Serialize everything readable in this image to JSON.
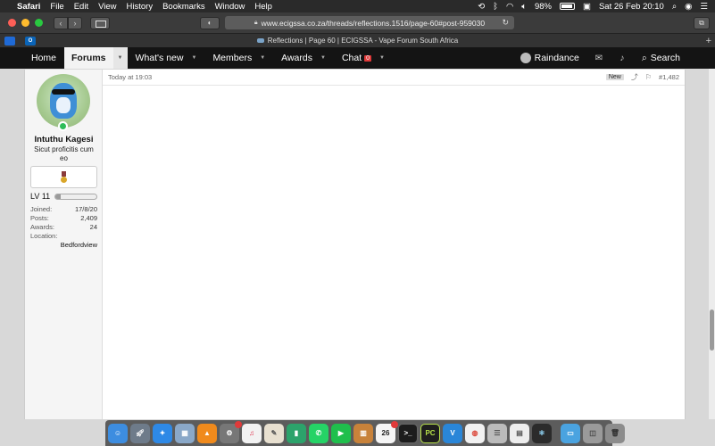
{
  "menubar": {
    "app": "Safari",
    "items": [
      "File",
      "Edit",
      "View",
      "History",
      "Bookmarks",
      "Window",
      "Help"
    ],
    "battery": "98%",
    "datetime": "Sat 26 Feb  20:10"
  },
  "browser": {
    "url": "www.ecigssa.co.za/threads/reflections.1516/page-60#post-959030",
    "tab_title": "Reflections | Page 60 | ECIGSSA - Vape Forum South Africa",
    "favorites": [
      "",
      "O"
    ]
  },
  "nav": {
    "home": "Home",
    "forums": "Forums",
    "whats_new": "What's new",
    "members": "Members",
    "awards": "Awards",
    "chat": "Chat",
    "chat_count": "0",
    "username": "Raindance",
    "search": "Search"
  },
  "post": {
    "time": "Today at 19:03",
    "badge": "New",
    "number": "#1,482",
    "user": {
      "name": "Intuthu Kagesi",
      "title": "Sicut proficitis cum eo",
      "level": "LV 11",
      "level_progress": 0.12,
      "stats": [
        {
          "label": "Joined:",
          "value": "17/8/20"
        },
        {
          "label": "Posts:",
          "value": "2,409"
        },
        {
          "label": "Awards:",
          "value": "24"
        },
        {
          "label": "Location:",
          "value": ""
        }
      ],
      "location": "Bedfordview"
    }
  },
  "dock": {
    "badges": {
      "settings": "",
      "calendar": "26",
      "calendar_badge": ""
    },
    "terminal": ">_",
    "pycharm": "PC",
    "vscode": "V"
  }
}
